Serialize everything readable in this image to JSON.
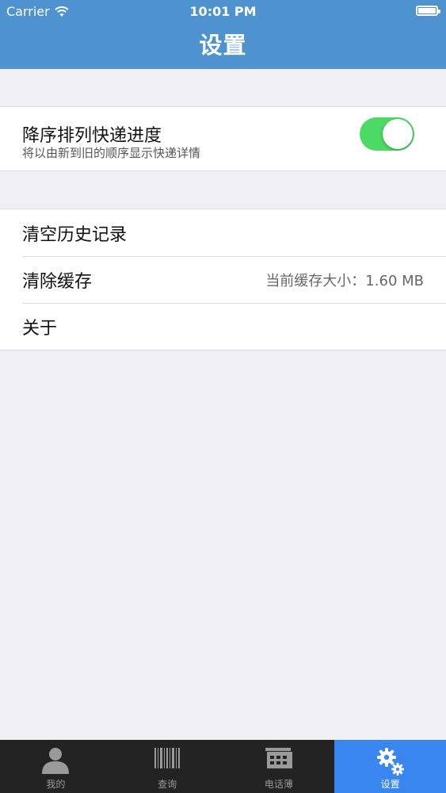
{
  "status_bar": {
    "carrier": "Carrier",
    "time": "10:01 PM"
  },
  "nav": {
    "title": "设置"
  },
  "settings": {
    "sort_toggle": {
      "title": "降序排列快递进度",
      "subtitle": "将以由新到旧的顺序显示快递详情",
      "enabled": true
    },
    "rows": [
      {
        "label": "清空历史记录"
      },
      {
        "label": "清除缓存",
        "value": "当前缓存大小：1.60 MB"
      },
      {
        "label": "关于"
      }
    ]
  },
  "tabbar": {
    "tabs": [
      {
        "label": "我的",
        "icon": "person-icon",
        "active": false
      },
      {
        "label": "查询",
        "icon": "barcode-icon",
        "active": false
      },
      {
        "label": "电话薄",
        "icon": "phonebook-icon",
        "active": false
      },
      {
        "label": "设置",
        "icon": "gears-icon",
        "active": true
      }
    ]
  },
  "colors": {
    "nav_bar": "#4e93cf",
    "switch_on": "#4cd964",
    "tab_active": "#3a86f0",
    "tabbar_bg": "#232323",
    "page_bg": "#efeff4"
  }
}
